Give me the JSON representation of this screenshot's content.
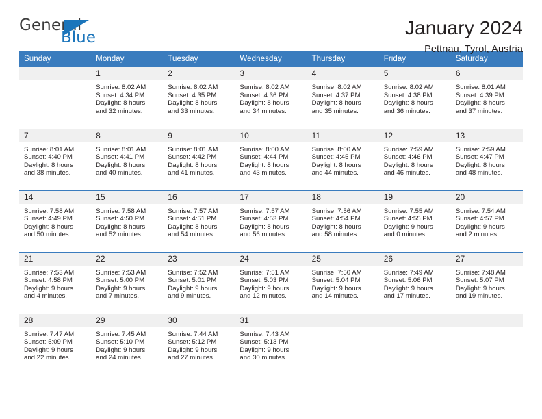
{
  "brand": {
    "name_part1": "General",
    "name_part2": "Blue",
    "triangle_icon": "triangle-icon",
    "accent_color": "#1b75bb"
  },
  "header": {
    "title": "January 2024",
    "subtitle": "Pettnau, Tyrol, Austria"
  },
  "theme": {
    "header_blue": "#3a7cbe",
    "daynum_band": "#f0f0f0",
    "text": "#231f20"
  },
  "weekdays": [
    "Sunday",
    "Monday",
    "Tuesday",
    "Wednesday",
    "Thursday",
    "Friday",
    "Saturday"
  ],
  "weeks": [
    [
      {
        "day": "",
        "sunrise": "",
        "sunset": "",
        "daylight_line1": "",
        "daylight_line2": ""
      },
      {
        "day": "1",
        "sunrise": "Sunrise: 8:02 AM",
        "sunset": "Sunset: 4:34 PM",
        "daylight_line1": "Daylight: 8 hours",
        "daylight_line2": "and 32 minutes."
      },
      {
        "day": "2",
        "sunrise": "Sunrise: 8:02 AM",
        "sunset": "Sunset: 4:35 PM",
        "daylight_line1": "Daylight: 8 hours",
        "daylight_line2": "and 33 minutes."
      },
      {
        "day": "3",
        "sunrise": "Sunrise: 8:02 AM",
        "sunset": "Sunset: 4:36 PM",
        "daylight_line1": "Daylight: 8 hours",
        "daylight_line2": "and 34 minutes."
      },
      {
        "day": "4",
        "sunrise": "Sunrise: 8:02 AM",
        "sunset": "Sunset: 4:37 PM",
        "daylight_line1": "Daylight: 8 hours",
        "daylight_line2": "and 35 minutes."
      },
      {
        "day": "5",
        "sunrise": "Sunrise: 8:02 AM",
        "sunset": "Sunset: 4:38 PM",
        "daylight_line1": "Daylight: 8 hours",
        "daylight_line2": "and 36 minutes."
      },
      {
        "day": "6",
        "sunrise": "Sunrise: 8:01 AM",
        "sunset": "Sunset: 4:39 PM",
        "daylight_line1": "Daylight: 8 hours",
        "daylight_line2": "and 37 minutes."
      }
    ],
    [
      {
        "day": "7",
        "sunrise": "Sunrise: 8:01 AM",
        "sunset": "Sunset: 4:40 PM",
        "daylight_line1": "Daylight: 8 hours",
        "daylight_line2": "and 38 minutes."
      },
      {
        "day": "8",
        "sunrise": "Sunrise: 8:01 AM",
        "sunset": "Sunset: 4:41 PM",
        "daylight_line1": "Daylight: 8 hours",
        "daylight_line2": "and 40 minutes."
      },
      {
        "day": "9",
        "sunrise": "Sunrise: 8:01 AM",
        "sunset": "Sunset: 4:42 PM",
        "daylight_line1": "Daylight: 8 hours",
        "daylight_line2": "and 41 minutes."
      },
      {
        "day": "10",
        "sunrise": "Sunrise: 8:00 AM",
        "sunset": "Sunset: 4:44 PM",
        "daylight_line1": "Daylight: 8 hours",
        "daylight_line2": "and 43 minutes."
      },
      {
        "day": "11",
        "sunrise": "Sunrise: 8:00 AM",
        "sunset": "Sunset: 4:45 PM",
        "daylight_line1": "Daylight: 8 hours",
        "daylight_line2": "and 44 minutes."
      },
      {
        "day": "12",
        "sunrise": "Sunrise: 7:59 AM",
        "sunset": "Sunset: 4:46 PM",
        "daylight_line1": "Daylight: 8 hours",
        "daylight_line2": "and 46 minutes."
      },
      {
        "day": "13",
        "sunrise": "Sunrise: 7:59 AM",
        "sunset": "Sunset: 4:47 PM",
        "daylight_line1": "Daylight: 8 hours",
        "daylight_line2": "and 48 minutes."
      }
    ],
    [
      {
        "day": "14",
        "sunrise": "Sunrise: 7:58 AM",
        "sunset": "Sunset: 4:49 PM",
        "daylight_line1": "Daylight: 8 hours",
        "daylight_line2": "and 50 minutes."
      },
      {
        "day": "15",
        "sunrise": "Sunrise: 7:58 AM",
        "sunset": "Sunset: 4:50 PM",
        "daylight_line1": "Daylight: 8 hours",
        "daylight_line2": "and 52 minutes."
      },
      {
        "day": "16",
        "sunrise": "Sunrise: 7:57 AM",
        "sunset": "Sunset: 4:51 PM",
        "daylight_line1": "Daylight: 8 hours",
        "daylight_line2": "and 54 minutes."
      },
      {
        "day": "17",
        "sunrise": "Sunrise: 7:57 AM",
        "sunset": "Sunset: 4:53 PM",
        "daylight_line1": "Daylight: 8 hours",
        "daylight_line2": "and 56 minutes."
      },
      {
        "day": "18",
        "sunrise": "Sunrise: 7:56 AM",
        "sunset": "Sunset: 4:54 PM",
        "daylight_line1": "Daylight: 8 hours",
        "daylight_line2": "and 58 minutes."
      },
      {
        "day": "19",
        "sunrise": "Sunrise: 7:55 AM",
        "sunset": "Sunset: 4:55 PM",
        "daylight_line1": "Daylight: 9 hours",
        "daylight_line2": "and 0 minutes."
      },
      {
        "day": "20",
        "sunrise": "Sunrise: 7:54 AM",
        "sunset": "Sunset: 4:57 PM",
        "daylight_line1": "Daylight: 9 hours",
        "daylight_line2": "and 2 minutes."
      }
    ],
    [
      {
        "day": "21",
        "sunrise": "Sunrise: 7:53 AM",
        "sunset": "Sunset: 4:58 PM",
        "daylight_line1": "Daylight: 9 hours",
        "daylight_line2": "and 4 minutes."
      },
      {
        "day": "22",
        "sunrise": "Sunrise: 7:53 AM",
        "sunset": "Sunset: 5:00 PM",
        "daylight_line1": "Daylight: 9 hours",
        "daylight_line2": "and 7 minutes."
      },
      {
        "day": "23",
        "sunrise": "Sunrise: 7:52 AM",
        "sunset": "Sunset: 5:01 PM",
        "daylight_line1": "Daylight: 9 hours",
        "daylight_line2": "and 9 minutes."
      },
      {
        "day": "24",
        "sunrise": "Sunrise: 7:51 AM",
        "sunset": "Sunset: 5:03 PM",
        "daylight_line1": "Daylight: 9 hours",
        "daylight_line2": "and 12 minutes."
      },
      {
        "day": "25",
        "sunrise": "Sunrise: 7:50 AM",
        "sunset": "Sunset: 5:04 PM",
        "daylight_line1": "Daylight: 9 hours",
        "daylight_line2": "and 14 minutes."
      },
      {
        "day": "26",
        "sunrise": "Sunrise: 7:49 AM",
        "sunset": "Sunset: 5:06 PM",
        "daylight_line1": "Daylight: 9 hours",
        "daylight_line2": "and 17 minutes."
      },
      {
        "day": "27",
        "sunrise": "Sunrise: 7:48 AM",
        "sunset": "Sunset: 5:07 PM",
        "daylight_line1": "Daylight: 9 hours",
        "daylight_line2": "and 19 minutes."
      }
    ],
    [
      {
        "day": "28",
        "sunrise": "Sunrise: 7:47 AM",
        "sunset": "Sunset: 5:09 PM",
        "daylight_line1": "Daylight: 9 hours",
        "daylight_line2": "and 22 minutes."
      },
      {
        "day": "29",
        "sunrise": "Sunrise: 7:45 AM",
        "sunset": "Sunset: 5:10 PM",
        "daylight_line1": "Daylight: 9 hours",
        "daylight_line2": "and 24 minutes."
      },
      {
        "day": "30",
        "sunrise": "Sunrise: 7:44 AM",
        "sunset": "Sunset: 5:12 PM",
        "daylight_line1": "Daylight: 9 hours",
        "daylight_line2": "and 27 minutes."
      },
      {
        "day": "31",
        "sunrise": "Sunrise: 7:43 AM",
        "sunset": "Sunset: 5:13 PM",
        "daylight_line1": "Daylight: 9 hours",
        "daylight_line2": "and 30 minutes."
      },
      {
        "day": "",
        "sunrise": "",
        "sunset": "",
        "daylight_line1": "",
        "daylight_line2": ""
      },
      {
        "day": "",
        "sunrise": "",
        "sunset": "",
        "daylight_line1": "",
        "daylight_line2": ""
      },
      {
        "day": "",
        "sunrise": "",
        "sunset": "",
        "daylight_line1": "",
        "daylight_line2": ""
      }
    ]
  ]
}
